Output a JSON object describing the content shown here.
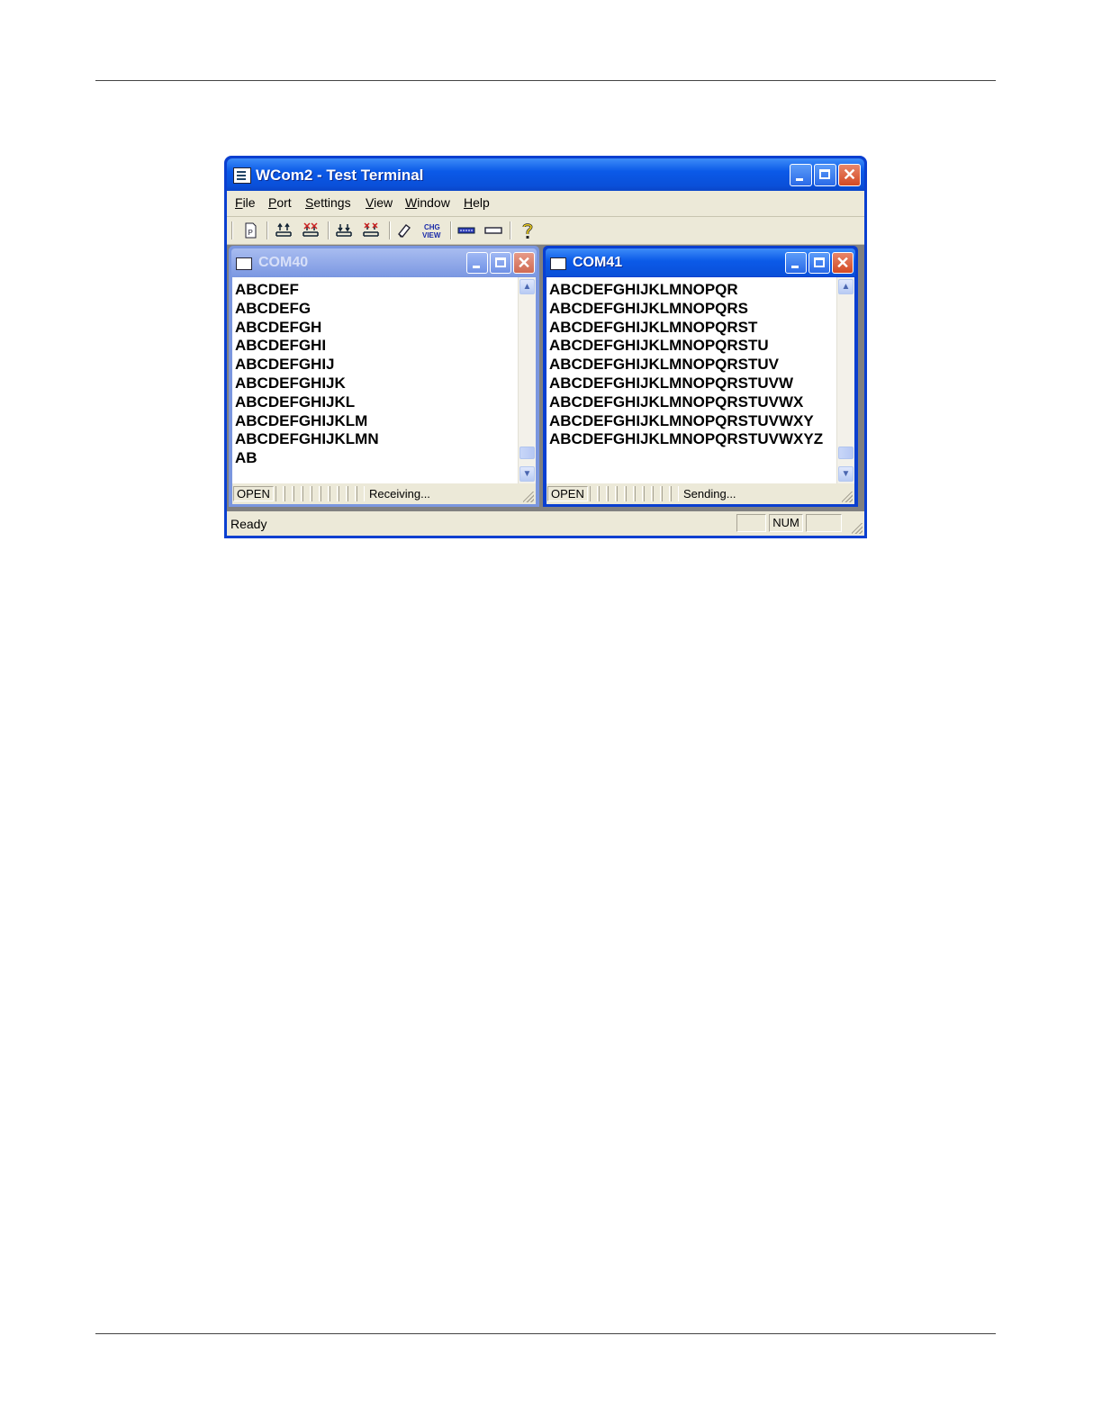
{
  "app": {
    "title": "WCom2 - Test Terminal",
    "menu": [
      "File",
      "Port",
      "Settings",
      "View",
      "Window",
      "Help"
    ],
    "toolbar_icons": [
      "new-doc-icon",
      "port-connect-icon",
      "port-disconnect-icon",
      "port-open-icon",
      "port-close-icon",
      "clear-icon",
      "chg-view-icon",
      "keyboard-icon",
      "input-bar-icon",
      "help-icon"
    ],
    "toolbar_chg_view_text": [
      "CHG",
      "VIEW"
    ],
    "status_ready": "Ready",
    "status_num": "NUM"
  },
  "windows": {
    "com40": {
      "title": "COM40",
      "lines": [
        "ABCDEF",
        "ABCDEFG",
        "ABCDEFGH",
        "ABCDEFGHI",
        "ABCDEFGHIJ",
        "ABCDEFGHIJK",
        "ABCDEFGHIJKL",
        "ABCDEFGHIJKLM",
        "ABCDEFGHIJKLMN",
        "AB"
      ],
      "status_open": "OPEN",
      "status_msg": "Receiving..."
    },
    "com41": {
      "title": "COM41",
      "lines": [
        "ABCDEFGHIJKLMNOPQR",
        "ABCDEFGHIJKLMNOPQRS",
        "ABCDEFGHIJKLMNOPQRST",
        "ABCDEFGHIJKLMNOPQRSTU",
        "ABCDEFGHIJKLMNOPQRSTUV",
        "ABCDEFGHIJKLMNOPQRSTUVW",
        "ABCDEFGHIJKLMNOPQRSTUVWX",
        "ABCDEFGHIJKLMNOPQRSTUVWXY",
        "ABCDEFGHIJKLMNOPQRSTUVWXYZ"
      ],
      "status_open": "OPEN",
      "status_msg": "Sending..."
    }
  },
  "colors": {
    "title_blue": "#0a5ae8",
    "xp_face": "#ece9d8",
    "close_red": "#d44a24"
  }
}
